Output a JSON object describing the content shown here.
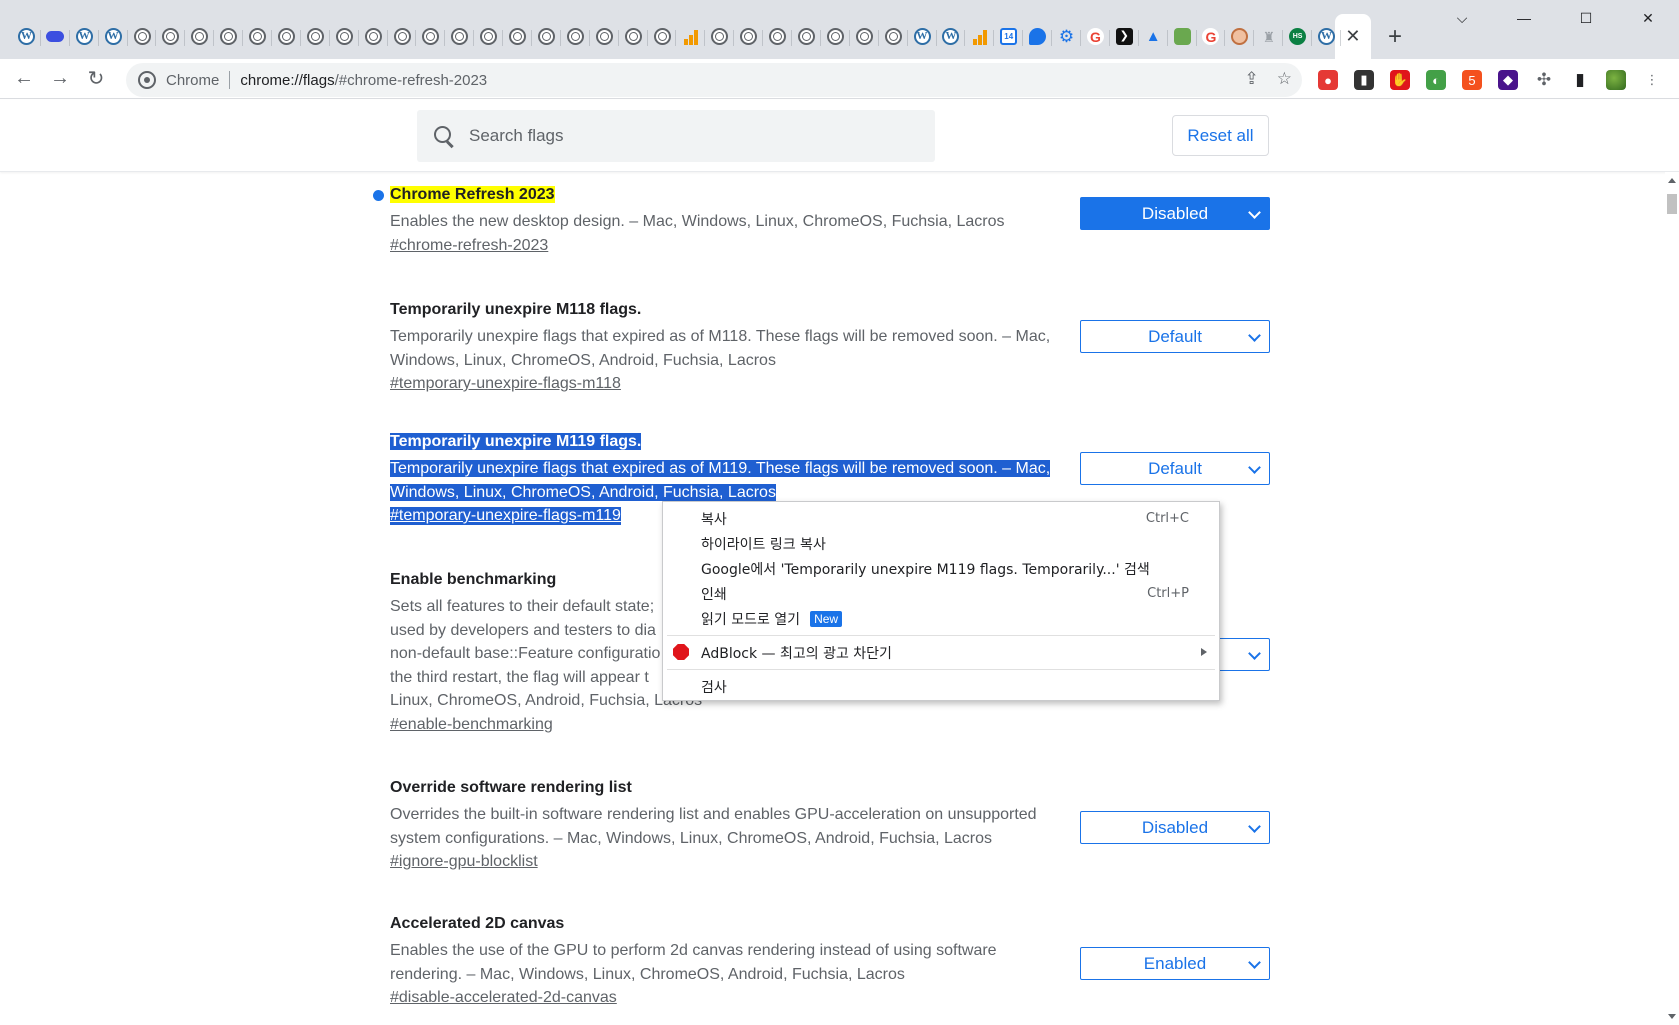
{
  "tabstrip": {
    "pinned_tabs": [
      {
        "icon": "wordpress-icon",
        "glyph": "W",
        "kind": "wp"
      },
      {
        "icon": "cloud-icon",
        "glyph": "",
        "kind": "cloud"
      },
      {
        "icon": "wordpress-icon",
        "glyph": "W",
        "kind": "wp"
      },
      {
        "icon": "wordpress-icon",
        "glyph": "W",
        "kind": "wp"
      },
      {
        "icon": "globe-icon",
        "glyph": "",
        "kind": "globe"
      },
      {
        "icon": "globe-icon",
        "glyph": "",
        "kind": "globe"
      },
      {
        "icon": "globe-icon",
        "glyph": "",
        "kind": "globe"
      },
      {
        "icon": "globe-icon",
        "glyph": "",
        "kind": "globe"
      },
      {
        "icon": "globe-icon",
        "glyph": "",
        "kind": "globe"
      },
      {
        "icon": "globe-icon",
        "glyph": "",
        "kind": "globe"
      },
      {
        "icon": "globe-icon",
        "glyph": "",
        "kind": "globe"
      },
      {
        "icon": "globe-icon",
        "glyph": "",
        "kind": "globe"
      },
      {
        "icon": "globe-icon",
        "glyph": "",
        "kind": "globe"
      },
      {
        "icon": "globe-icon",
        "glyph": "",
        "kind": "globe"
      },
      {
        "icon": "globe-icon",
        "glyph": "",
        "kind": "globe"
      },
      {
        "icon": "globe-icon",
        "glyph": "",
        "kind": "globe"
      },
      {
        "icon": "globe-icon",
        "glyph": "",
        "kind": "globe"
      },
      {
        "icon": "globe-icon",
        "glyph": "",
        "kind": "globe"
      },
      {
        "icon": "globe-icon",
        "glyph": "",
        "kind": "globe"
      },
      {
        "icon": "globe-icon",
        "glyph": "",
        "kind": "globe"
      },
      {
        "icon": "globe-icon",
        "glyph": "",
        "kind": "globe"
      },
      {
        "icon": "globe-icon",
        "glyph": "",
        "kind": "globe"
      },
      {
        "icon": "globe-icon",
        "glyph": "",
        "kind": "globe"
      },
      {
        "icon": "analytics-icon",
        "glyph": "",
        "kind": "bars"
      },
      {
        "icon": "globe-icon",
        "glyph": "",
        "kind": "globe"
      },
      {
        "icon": "globe-icon",
        "glyph": "",
        "kind": "globe"
      },
      {
        "icon": "globe-icon",
        "glyph": "",
        "kind": "globe"
      },
      {
        "icon": "globe-icon",
        "glyph": "",
        "kind": "globe"
      },
      {
        "icon": "globe-icon",
        "glyph": "",
        "kind": "globe"
      },
      {
        "icon": "globe-icon",
        "glyph": "",
        "kind": "globe"
      },
      {
        "icon": "globe-icon",
        "glyph": "",
        "kind": "globe"
      },
      {
        "icon": "wordpress-icon",
        "glyph": "W",
        "kind": "wp"
      },
      {
        "icon": "wordpress-icon",
        "glyph": "W",
        "kind": "wp"
      },
      {
        "icon": "analytics-icon",
        "glyph": "",
        "kind": "bars"
      },
      {
        "icon": "calendar-icon",
        "glyph": "14",
        "kind": "cal"
      },
      {
        "icon": "chat-icon",
        "glyph": "",
        "kind": "chat"
      },
      {
        "icon": "gear-icon",
        "glyph": "⚙",
        "kind": "gear"
      },
      {
        "icon": "google-icon",
        "glyph": "G",
        "kind": "g"
      },
      {
        "icon": "arrow-icon",
        "glyph": "❯",
        "kind": "arrow"
      },
      {
        "icon": "flask-icon",
        "glyph": "▲",
        "kind": "flask"
      },
      {
        "icon": "puzzle-icon",
        "glyph": "",
        "kind": "puzzle"
      },
      {
        "icon": "google-icon",
        "glyph": "G",
        "kind": "g"
      },
      {
        "icon": "face-icon",
        "glyph": "",
        "kind": "face"
      },
      {
        "icon": "bell-icon",
        "glyph": "♜",
        "kind": "bell"
      },
      {
        "icon": "hs-icon",
        "glyph": "HS",
        "kind": "hs"
      },
      {
        "icon": "wordpress-icon",
        "glyph": "W",
        "kind": "wp"
      }
    ],
    "active_tab_close": "✕",
    "new_tab": "+",
    "window_controls": {
      "minimize": "⌵",
      "restore": "—",
      "maximize": "☐",
      "close": "✕"
    }
  },
  "toolbar": {
    "back": "←",
    "forward": "→",
    "reload": "↻",
    "chip": "Chrome",
    "url_host": "chrome://flags",
    "url_rest": "/#chrome-refresh-2023",
    "share": "⇪",
    "bookmark": "☆",
    "extensions": [
      {
        "icon": "color-wheel-icon",
        "color": "#e53935"
      },
      {
        "icon": "sidebar-extension-icon",
        "color": "#333333"
      },
      {
        "icon": "adblock-icon",
        "color": "#e0151b"
      },
      {
        "icon": "leaf-icon",
        "color": "#43a047"
      },
      {
        "icon": "html5-icon",
        "color": "#f4511e"
      },
      {
        "icon": "cube-icon",
        "color": "#4a148c"
      }
    ],
    "puzzle": "✣",
    "side_panel": "▮",
    "menu": "⋮"
  },
  "search": {
    "placeholder": "Search flags",
    "reset_label": "Reset all"
  },
  "flags": [
    {
      "title": "Chrome Refresh 2023",
      "desc": "Enables the new desktop design. – Mac, Windows, Linux, ChromeOS, Fuchsia, Lacros",
      "link": "#chrome-refresh-2023",
      "value": "Disabled"
    },
    {
      "title": "Temporarily unexpire M118 flags.",
      "desc": "Temporarily unexpire flags that expired as of M118. These flags will be removed soon. – Mac, Windows, Linux, ChromeOS, Android, Fuchsia, Lacros",
      "link": "#temporary-unexpire-flags-m118",
      "value": "Default"
    },
    {
      "title": "Temporarily unexpire M119 flags.",
      "desc": "Temporarily unexpire flags that expired as of M119. These flags will be removed soon. – Mac, Windows, Linux, ChromeOS, Android, Fuchsia, Lacros",
      "link": "#temporary-unexpire-flags-m119",
      "value": "Default"
    },
    {
      "title": "Enable benchmarking",
      "desc_lines": [
        "Sets all features to their default state;",
        "used by developers and testers to dia",
        "non-default base::Feature configuratio",
        "the third restart, the flag will appear t",
        "Linux, ChromeOS, Android, Fuchsia, Lacros"
      ],
      "link": "#enable-benchmarking",
      "value": ""
    },
    {
      "title": "Override software rendering list",
      "desc": "Overrides the built-in software rendering list and enables GPU-acceleration on unsupported system configurations. – Mac, Windows, Linux, ChromeOS, Android, Fuchsia, Lacros",
      "link": "#ignore-gpu-blocklist",
      "value": "Disabled"
    },
    {
      "title": "Accelerated 2D canvas",
      "desc": "Enables the use of the GPU to perform 2d canvas rendering instead of using software rendering. – Mac, Windows, Linux, ChromeOS, Android, Fuchsia, Lacros",
      "link": "#disable-accelerated-2d-canvas",
      "value": "Enabled"
    }
  ],
  "context_menu": {
    "copy": "복사",
    "copy_shortcut": "Ctrl+C",
    "copy_highlight_link": "하이라이트 링크 복사",
    "search_google": "Google에서 'Temporarily unexpire M119 flags. Temporarily...' 검색",
    "print": "인쇄",
    "print_shortcut": "Ctrl+P",
    "reading_mode": "읽기 모드로 열기",
    "new_badge": "New",
    "adblock": "AdBlock — 최고의 광고 차단기",
    "inspect": "검사"
  },
  "colors": {
    "accent": "#1a73e8",
    "selection": "#1f5fd1",
    "highlight": "#ffff00"
  }
}
